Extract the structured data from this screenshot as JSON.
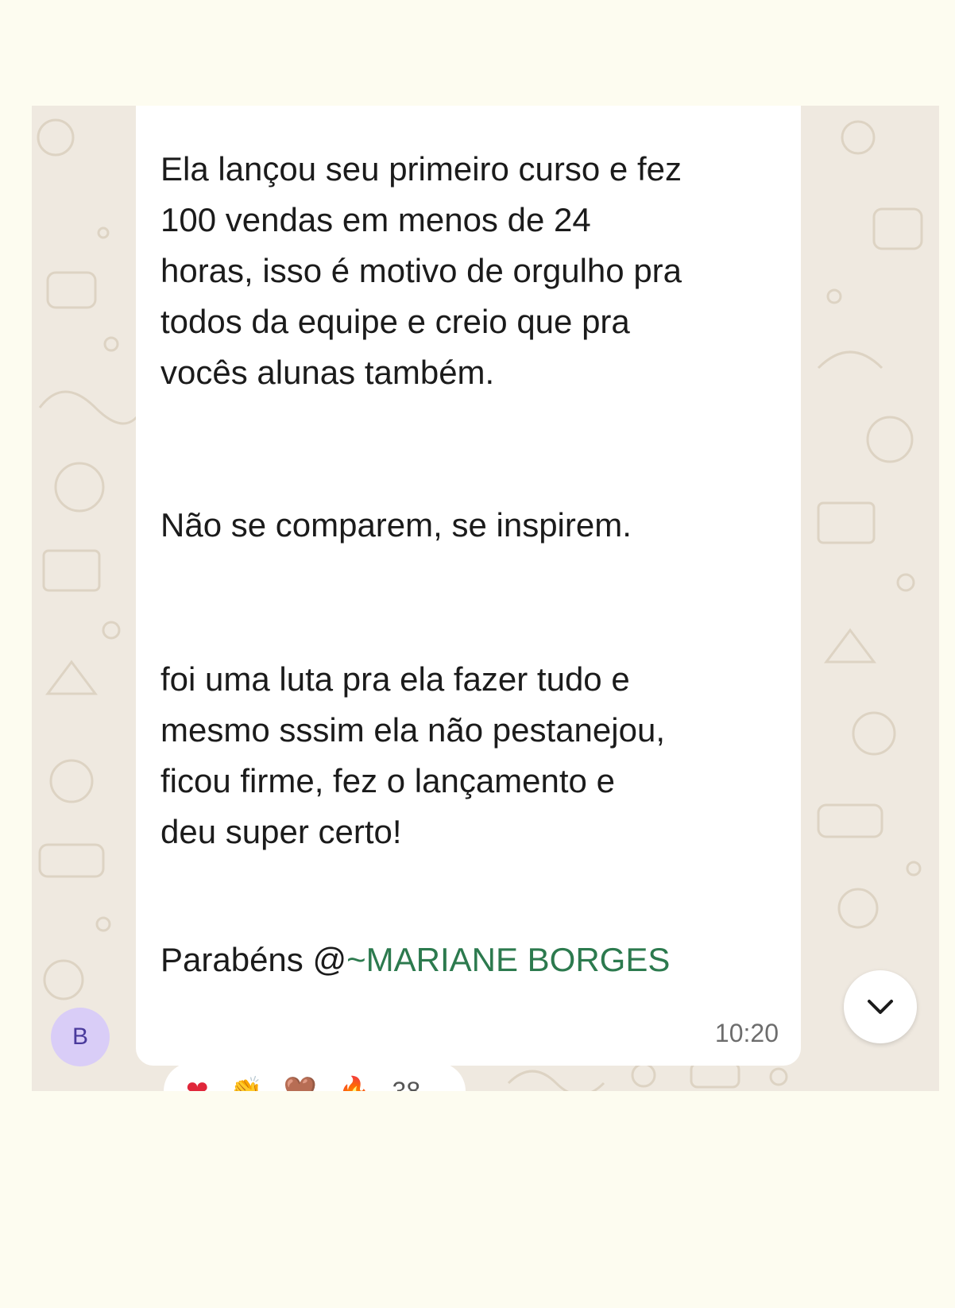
{
  "message": {
    "paragraphs": [
      "Ela lançou seu primeiro curso e fez\n100 vendas em menos de 24\nhoras, isso é motivo de orgulho pra\ntodos da equipe e creio que pra\nvocês alunas também.",
      "Não se comparem, se inspirem.",
      "foi uma luta pra ela fazer tudo e\nmesmo sssim ela não pestanejou,\nficou firme, fez o lançamento e\ndeu super certo!"
    ],
    "congrats_prefix": "Parabéns @",
    "mention": "~MARIANE BORGES",
    "time": "10:20"
  },
  "avatar": {
    "initial": "B"
  },
  "reactions": {
    "emojis": [
      "❤",
      "👏",
      "🤎",
      "🔥"
    ],
    "count": "38"
  },
  "colors": {
    "page_background": "#fdfcf0",
    "chat_wallpaper": "#efe9e0",
    "bubble": "#ffffff",
    "mention": "#2c7a4e",
    "avatar_bg": "#d9cdf7",
    "avatar_text": "#4a3a9c"
  },
  "icons": {
    "scroll_down": "chevron-down-icon"
  }
}
